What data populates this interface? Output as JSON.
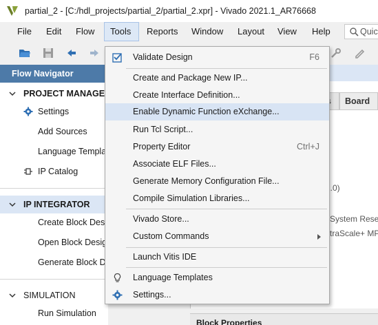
{
  "window": {
    "title": "partial_2 - [C:/hdl_projects/partial_2/partial_2.xpr] - Vivado 2021.1_AR76668"
  },
  "menubar": {
    "items": [
      {
        "label": "File"
      },
      {
        "label": "Edit"
      },
      {
        "label": "Flow"
      },
      {
        "label": "Tools"
      },
      {
        "label": "Reports"
      },
      {
        "label": "Window"
      },
      {
        "label": "Layout"
      },
      {
        "label": "View"
      },
      {
        "label": "Help"
      }
    ],
    "active_item": "Tools",
    "quick_access_placeholder": "Quic"
  },
  "toolbar": {
    "icons": [
      "open-project-icon",
      "save-icon",
      "undo-icon",
      "redo-icon",
      "settings-wrench-icon",
      "edit-icon"
    ]
  },
  "flow_navigator": {
    "title": "Flow Navigator",
    "sections": [
      {
        "label": "PROJECT MANAGER",
        "items": [
          {
            "label": "Settings",
            "icon": "gear-icon"
          },
          {
            "label": "Add Sources"
          },
          {
            "label": "Language Templates"
          },
          {
            "label": "IP Catalog",
            "icon": "ip-catalog-icon"
          }
        ]
      },
      {
        "label": "IP INTEGRATOR",
        "selected": true,
        "items": [
          {
            "label": "Create Block Design"
          },
          {
            "label": "Open Block Design"
          },
          {
            "label": "Generate Block Design"
          }
        ]
      },
      {
        "label": "SIMULATION",
        "items": [
          {
            "label": "Run Simulation"
          }
        ]
      }
    ]
  },
  "background_panel": {
    "tab_board": "Board",
    "tab_partial": "s",
    "fragment_version": "1.0)",
    "fragment_system_reset": "System Rese",
    "fragment_ultrascale": "traScale+ MP",
    "block_properties": "Block Properties"
  },
  "tools_menu": {
    "items": [
      {
        "label": "Validate Design",
        "shortcut": "F6",
        "icon": "validate-check-icon"
      },
      {
        "label": "Create and Package New IP..."
      },
      {
        "label": "Create Interface Definition..."
      },
      {
        "label": "Enable Dynamic Function eXchange...",
        "highlighted": true
      },
      {
        "label": "Run Tcl Script..."
      },
      {
        "label": "Property Editor",
        "shortcut": "Ctrl+J"
      },
      {
        "label": "Associate ELF Files..."
      },
      {
        "label": "Generate Memory Configuration File..."
      },
      {
        "label": "Compile Simulation Libraries..."
      },
      {
        "label": "Vivado Store..."
      },
      {
        "label": "Custom Commands",
        "submenu": true
      },
      {
        "label": "Launch Vitis IDE"
      },
      {
        "label": "Language Templates",
        "icon": "lightbulb-icon"
      },
      {
        "label": "Settings...",
        "icon": "gear-icon"
      }
    ]
  },
  "colors": {
    "nav_header_bg": "#4d7aa8",
    "selection_bg": "#dbe6f5",
    "menu_highlight": "#d8e4f4",
    "icon_blue": "#2f6fb3"
  }
}
